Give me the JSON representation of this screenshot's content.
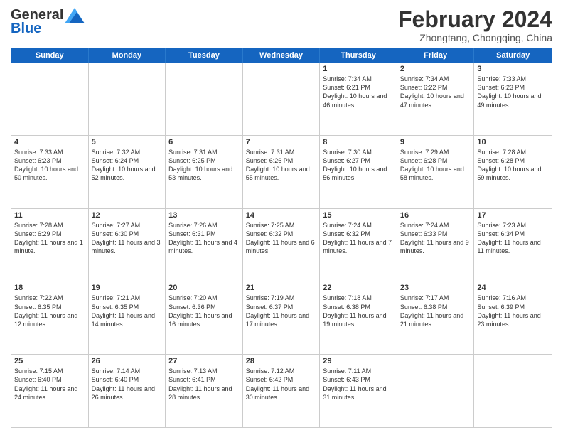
{
  "header": {
    "logo_line1": "General",
    "logo_line2": "Blue",
    "month": "February 2024",
    "location": "Zhongtang, Chongqing, China"
  },
  "days_of_week": [
    "Sunday",
    "Monday",
    "Tuesday",
    "Wednesday",
    "Thursday",
    "Friday",
    "Saturday"
  ],
  "weeks": [
    [
      {
        "day": "",
        "info": ""
      },
      {
        "day": "",
        "info": ""
      },
      {
        "day": "",
        "info": ""
      },
      {
        "day": "",
        "info": ""
      },
      {
        "day": "1",
        "info": "Sunrise: 7:34 AM\nSunset: 6:21 PM\nDaylight: 10 hours and 46 minutes."
      },
      {
        "day": "2",
        "info": "Sunrise: 7:34 AM\nSunset: 6:22 PM\nDaylight: 10 hours and 47 minutes."
      },
      {
        "day": "3",
        "info": "Sunrise: 7:33 AM\nSunset: 6:23 PM\nDaylight: 10 hours and 49 minutes."
      }
    ],
    [
      {
        "day": "4",
        "info": "Sunrise: 7:33 AM\nSunset: 6:23 PM\nDaylight: 10 hours and 50 minutes."
      },
      {
        "day": "5",
        "info": "Sunrise: 7:32 AM\nSunset: 6:24 PM\nDaylight: 10 hours and 52 minutes."
      },
      {
        "day": "6",
        "info": "Sunrise: 7:31 AM\nSunset: 6:25 PM\nDaylight: 10 hours and 53 minutes."
      },
      {
        "day": "7",
        "info": "Sunrise: 7:31 AM\nSunset: 6:26 PM\nDaylight: 10 hours and 55 minutes."
      },
      {
        "day": "8",
        "info": "Sunrise: 7:30 AM\nSunset: 6:27 PM\nDaylight: 10 hours and 56 minutes."
      },
      {
        "day": "9",
        "info": "Sunrise: 7:29 AM\nSunset: 6:28 PM\nDaylight: 10 hours and 58 minutes."
      },
      {
        "day": "10",
        "info": "Sunrise: 7:28 AM\nSunset: 6:28 PM\nDaylight: 10 hours and 59 minutes."
      }
    ],
    [
      {
        "day": "11",
        "info": "Sunrise: 7:28 AM\nSunset: 6:29 PM\nDaylight: 11 hours and 1 minute."
      },
      {
        "day": "12",
        "info": "Sunrise: 7:27 AM\nSunset: 6:30 PM\nDaylight: 11 hours and 3 minutes."
      },
      {
        "day": "13",
        "info": "Sunrise: 7:26 AM\nSunset: 6:31 PM\nDaylight: 11 hours and 4 minutes."
      },
      {
        "day": "14",
        "info": "Sunrise: 7:25 AM\nSunset: 6:32 PM\nDaylight: 11 hours and 6 minutes."
      },
      {
        "day": "15",
        "info": "Sunrise: 7:24 AM\nSunset: 6:32 PM\nDaylight: 11 hours and 7 minutes."
      },
      {
        "day": "16",
        "info": "Sunrise: 7:24 AM\nSunset: 6:33 PM\nDaylight: 11 hours and 9 minutes."
      },
      {
        "day": "17",
        "info": "Sunrise: 7:23 AM\nSunset: 6:34 PM\nDaylight: 11 hours and 11 minutes."
      }
    ],
    [
      {
        "day": "18",
        "info": "Sunrise: 7:22 AM\nSunset: 6:35 PM\nDaylight: 11 hours and 12 minutes."
      },
      {
        "day": "19",
        "info": "Sunrise: 7:21 AM\nSunset: 6:35 PM\nDaylight: 11 hours and 14 minutes."
      },
      {
        "day": "20",
        "info": "Sunrise: 7:20 AM\nSunset: 6:36 PM\nDaylight: 11 hours and 16 minutes."
      },
      {
        "day": "21",
        "info": "Sunrise: 7:19 AM\nSunset: 6:37 PM\nDaylight: 11 hours and 17 minutes."
      },
      {
        "day": "22",
        "info": "Sunrise: 7:18 AM\nSunset: 6:38 PM\nDaylight: 11 hours and 19 minutes."
      },
      {
        "day": "23",
        "info": "Sunrise: 7:17 AM\nSunset: 6:38 PM\nDaylight: 11 hours and 21 minutes."
      },
      {
        "day": "24",
        "info": "Sunrise: 7:16 AM\nSunset: 6:39 PM\nDaylight: 11 hours and 23 minutes."
      }
    ],
    [
      {
        "day": "25",
        "info": "Sunrise: 7:15 AM\nSunset: 6:40 PM\nDaylight: 11 hours and 24 minutes."
      },
      {
        "day": "26",
        "info": "Sunrise: 7:14 AM\nSunset: 6:40 PM\nDaylight: 11 hours and 26 minutes."
      },
      {
        "day": "27",
        "info": "Sunrise: 7:13 AM\nSunset: 6:41 PM\nDaylight: 11 hours and 28 minutes."
      },
      {
        "day": "28",
        "info": "Sunrise: 7:12 AM\nSunset: 6:42 PM\nDaylight: 11 hours and 30 minutes."
      },
      {
        "day": "29",
        "info": "Sunrise: 7:11 AM\nSunset: 6:43 PM\nDaylight: 11 hours and 31 minutes."
      },
      {
        "day": "",
        "info": ""
      },
      {
        "day": "",
        "info": ""
      }
    ]
  ]
}
